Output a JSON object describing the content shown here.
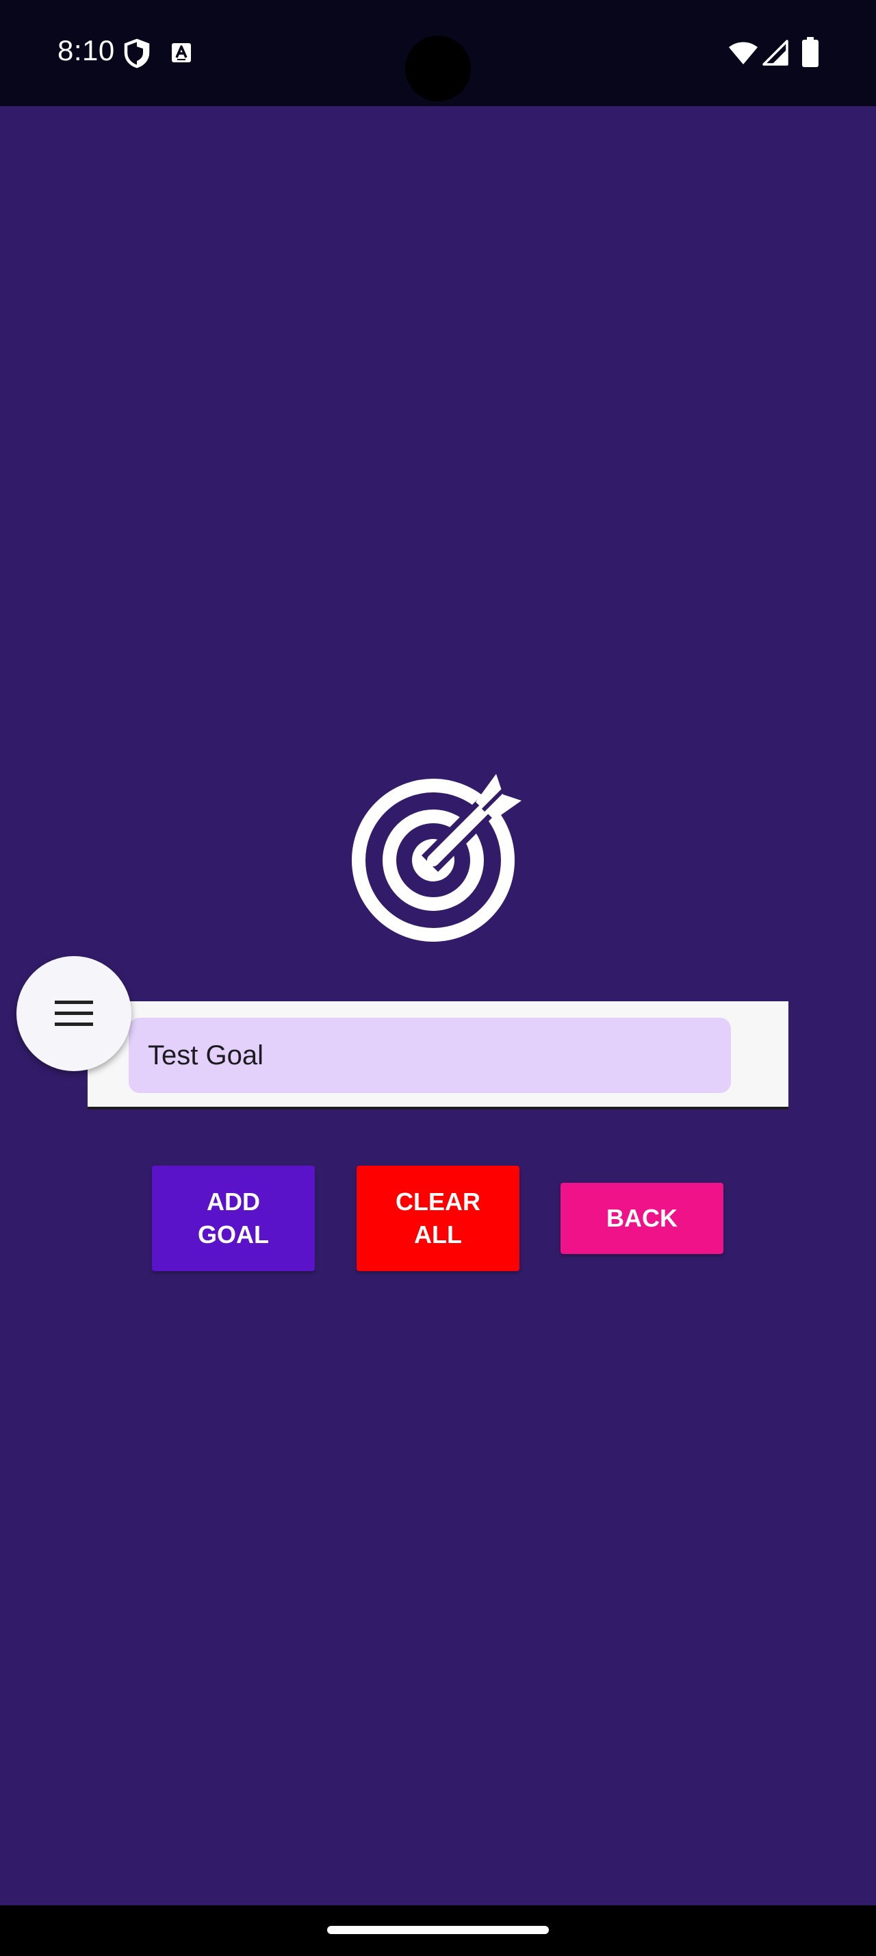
{
  "status_bar": {
    "time": "8:10",
    "icons": [
      "shield-icon",
      "text-a-icon",
      "wifi-icon",
      "signal-icon",
      "battery-icon"
    ]
  },
  "main": {
    "icon": "target-arrow-icon",
    "menu_button_icon": "hamburger-menu-icon",
    "goal_input": {
      "value": "Test Goal",
      "placeholder": ""
    },
    "buttons": {
      "add_goal": "ADD\nGOAL",
      "clear_all": "CLEAR\nALL",
      "back": "BACK"
    }
  },
  "colors": {
    "background": "#321c69",
    "status_bar": "#07061a",
    "input_fill": "#e3d1fb",
    "add_goal_button": "#5a13c9",
    "clear_all_button": "#ff0000",
    "back_button": "#ef1289",
    "fab": "#f6f5f9"
  }
}
